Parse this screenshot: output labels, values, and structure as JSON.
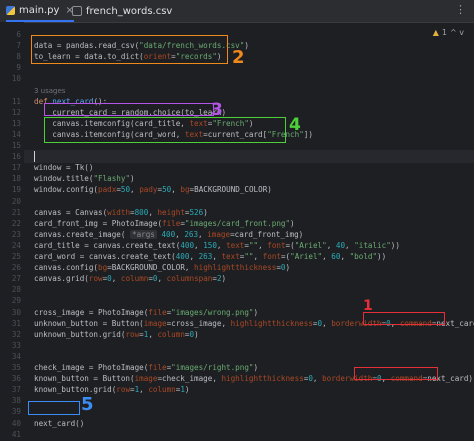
{
  "tabs": [
    {
      "label": "main.py",
      "active": true,
      "icon": "python-file-icon"
    },
    {
      "label": "french_words.csv",
      "active": false,
      "icon": "csv-file-icon"
    }
  ],
  "warnings": {
    "icon": "warning-icon",
    "count": "1",
    "arrows": "^ v"
  },
  "usages_hint": "3 usages",
  "colors": {
    "background": "#1e1f22",
    "keyword": "#cf8e6d",
    "function": "#56a8f5",
    "string": "#6aab73",
    "number": "#2aacb8",
    "parameter": "#aa4926",
    "annotation_red": "#e5303a",
    "annotation_orange": "#f0891b",
    "annotation_purple": "#b455e8",
    "annotation_green": "#4cd03a",
    "annotation_blue": "#3b8cf5"
  },
  "lines": [
    {
      "n": "6",
      "segs": []
    },
    {
      "n": "7",
      "segs": [
        {
          "t": "data = pandas.read_csv("
        },
        {
          "t": "\"data/french_words.csv\"",
          "c": "str"
        },
        {
          "t": ")"
        }
      ]
    },
    {
      "n": "8",
      "segs": [
        {
          "t": "to_learn = data.to_dict("
        },
        {
          "t": "orient",
          "c": "param"
        },
        {
          "t": "="
        },
        {
          "t": "\"records\"",
          "c": "str"
        },
        {
          "t": ")"
        }
      ]
    },
    {
      "n": "9",
      "segs": []
    },
    {
      "n": "10",
      "segs": []
    },
    {
      "n": "",
      "segs": [
        {
          "t": "3 usages",
          "c": "hint"
        }
      ]
    },
    {
      "n": "11",
      "segs": [
        {
          "t": "def ",
          "c": "kw"
        },
        {
          "t": "next_card",
          "c": "fn"
        },
        {
          "t": "():"
        }
      ]
    },
    {
      "n": "12",
      "segs": [
        {
          "t": "    current_card = random.choice(to_learn)"
        }
      ]
    },
    {
      "n": "13",
      "segs": [
        {
          "t": "    canvas.itemconfig(card_title, "
        },
        {
          "t": "text",
          "c": "param"
        },
        {
          "t": "="
        },
        {
          "t": "\"French\"",
          "c": "str"
        },
        {
          "t": ")"
        }
      ]
    },
    {
      "n": "14",
      "segs": [
        {
          "t": "    canvas.itemconfig(card_word, "
        },
        {
          "t": "text",
          "c": "param"
        },
        {
          "t": "=current_card["
        },
        {
          "t": "\"French\"",
          "c": "str"
        },
        {
          "t": "])"
        }
      ]
    },
    {
      "n": "15",
      "segs": []
    },
    {
      "n": "16",
      "segs": []
    },
    {
      "n": "17",
      "segs": [
        {
          "t": "window = Tk()"
        }
      ]
    },
    {
      "n": "18",
      "segs": [
        {
          "t": "window.title("
        },
        {
          "t": "\"Flashy\"",
          "c": "str"
        },
        {
          "t": ")"
        }
      ]
    },
    {
      "n": "19",
      "segs": [
        {
          "t": "window.config("
        },
        {
          "t": "padx",
          "c": "param"
        },
        {
          "t": "="
        },
        {
          "t": "50",
          "c": "num"
        },
        {
          "t": ", "
        },
        {
          "t": "pady",
          "c": "param"
        },
        {
          "t": "="
        },
        {
          "t": "50",
          "c": "num"
        },
        {
          "t": ", "
        },
        {
          "t": "bg",
          "c": "param"
        },
        {
          "t": "=BACKGROUND_COLOR)"
        }
      ]
    },
    {
      "n": "20",
      "segs": []
    },
    {
      "n": "21",
      "segs": [
        {
          "t": "canvas = Canvas("
        },
        {
          "t": "width",
          "c": "param"
        },
        {
          "t": "="
        },
        {
          "t": "800",
          "c": "num"
        },
        {
          "t": ", "
        },
        {
          "t": "height",
          "c": "param"
        },
        {
          "t": "="
        },
        {
          "t": "526",
          "c": "num"
        },
        {
          "t": ")"
        }
      ]
    },
    {
      "n": "22",
      "segs": [
        {
          "t": "card_front_img = PhotoImage("
        },
        {
          "t": "file",
          "c": "param"
        },
        {
          "t": "="
        },
        {
          "t": "\"images/card_front.png\"",
          "c": "str"
        },
        {
          "t": ")"
        }
      ]
    },
    {
      "n": "23",
      "segs": [
        {
          "t": "canvas.create_image( "
        },
        {
          "t": "*args",
          "c": "inlay"
        },
        {
          "t": " "
        },
        {
          "t": "400",
          "c": "num"
        },
        {
          "t": ", "
        },
        {
          "t": "263",
          "c": "num"
        },
        {
          "t": ", "
        },
        {
          "t": "image",
          "c": "param"
        },
        {
          "t": "=card_front_img)"
        }
      ]
    },
    {
      "n": "24",
      "segs": [
        {
          "t": "card_title = canvas.create_text("
        },
        {
          "t": "400",
          "c": "num"
        },
        {
          "t": ", "
        },
        {
          "t": "150",
          "c": "num"
        },
        {
          "t": ", "
        },
        {
          "t": "text",
          "c": "param"
        },
        {
          "t": "="
        },
        {
          "t": "\"\"",
          "c": "str"
        },
        {
          "t": ", "
        },
        {
          "t": "font",
          "c": "param"
        },
        {
          "t": "=("
        },
        {
          "t": "\"Ariel\"",
          "c": "str"
        },
        {
          "t": ", "
        },
        {
          "t": "40",
          "c": "num"
        },
        {
          "t": ", "
        },
        {
          "t": "\"italic\"",
          "c": "str"
        },
        {
          "t": "))"
        }
      ]
    },
    {
      "n": "25",
      "segs": [
        {
          "t": "card_word = canvas.create_text("
        },
        {
          "t": "400",
          "c": "num"
        },
        {
          "t": ", "
        },
        {
          "t": "263",
          "c": "num"
        },
        {
          "t": ", "
        },
        {
          "t": "text",
          "c": "param"
        },
        {
          "t": "="
        },
        {
          "t": "\"\"",
          "c": "str"
        },
        {
          "t": ", "
        },
        {
          "t": "font",
          "c": "param"
        },
        {
          "t": "=("
        },
        {
          "t": "\"Ariel\"",
          "c": "str"
        },
        {
          "t": ", "
        },
        {
          "t": "60",
          "c": "num"
        },
        {
          "t": ", "
        },
        {
          "t": "\"bold\"",
          "c": "str"
        },
        {
          "t": "))"
        }
      ]
    },
    {
      "n": "26",
      "segs": [
        {
          "t": "canvas.config("
        },
        {
          "t": "bg",
          "c": "param"
        },
        {
          "t": "=BACKGROUND_COLOR, "
        },
        {
          "t": "highlightthickness",
          "c": "param"
        },
        {
          "t": "="
        },
        {
          "t": "0",
          "c": "num"
        },
        {
          "t": ")"
        }
      ]
    },
    {
      "n": "27",
      "segs": [
        {
          "t": "canvas.grid("
        },
        {
          "t": "row",
          "c": "param"
        },
        {
          "t": "="
        },
        {
          "t": "0",
          "c": "num"
        },
        {
          "t": ", "
        },
        {
          "t": "column",
          "c": "param"
        },
        {
          "t": "="
        },
        {
          "t": "0",
          "c": "num"
        },
        {
          "t": ", "
        },
        {
          "t": "columnspan",
          "c": "param"
        },
        {
          "t": "="
        },
        {
          "t": "2",
          "c": "num"
        },
        {
          "t": ")"
        }
      ]
    },
    {
      "n": "28",
      "segs": []
    },
    {
      "n": "29",
      "segs": []
    },
    {
      "n": "30",
      "segs": [
        {
          "t": "cross_image = PhotoImage("
        },
        {
          "t": "file",
          "c": "param"
        },
        {
          "t": "="
        },
        {
          "t": "\"images/wrong.png\"",
          "c": "str"
        },
        {
          "t": ")"
        }
      ]
    },
    {
      "n": "31",
      "segs": [
        {
          "t": "unknown_button = Button("
        },
        {
          "t": "image",
          "c": "param"
        },
        {
          "t": "=cross_image, "
        },
        {
          "t": "highlightthickness",
          "c": "param"
        },
        {
          "t": "="
        },
        {
          "t": "0",
          "c": "num"
        },
        {
          "t": ", "
        },
        {
          "t": "borderwidth",
          "c": "param"
        },
        {
          "t": "="
        },
        {
          "t": "0",
          "c": "num"
        },
        {
          "t": ", "
        },
        {
          "t": "command",
          "c": "param"
        },
        {
          "t": "=next_card)"
        }
      ]
    },
    {
      "n": "32",
      "segs": [
        {
          "t": "unknown_button.grid("
        },
        {
          "t": "row",
          "c": "param"
        },
        {
          "t": "="
        },
        {
          "t": "1",
          "c": "num"
        },
        {
          "t": ", "
        },
        {
          "t": "column",
          "c": "param"
        },
        {
          "t": "="
        },
        {
          "t": "0",
          "c": "num"
        },
        {
          "t": ")"
        }
      ]
    },
    {
      "n": "33",
      "segs": []
    },
    {
      "n": "34",
      "segs": []
    },
    {
      "n": "35",
      "segs": [
        {
          "t": "check_image = PhotoImage("
        },
        {
          "t": "file",
          "c": "param"
        },
        {
          "t": "="
        },
        {
          "t": "\"images/right.png\"",
          "c": "str"
        },
        {
          "t": ")"
        }
      ]
    },
    {
      "n": "36",
      "segs": [
        {
          "t": "known_button = Button("
        },
        {
          "t": "image",
          "c": "param"
        },
        {
          "t": "=check_image, "
        },
        {
          "t": "highlightthickness",
          "c": "param"
        },
        {
          "t": "="
        },
        {
          "t": "0",
          "c": "num"
        },
        {
          "t": ", "
        },
        {
          "t": "borderwidth",
          "c": "param"
        },
        {
          "t": "="
        },
        {
          "t": "0",
          "c": "num"
        },
        {
          "t": ", "
        },
        {
          "t": "command",
          "c": "param"
        },
        {
          "t": "=next_card)"
        }
      ]
    },
    {
      "n": "37",
      "segs": [
        {
          "t": "known_button.grid("
        },
        {
          "t": "row",
          "c": "param"
        },
        {
          "t": "="
        },
        {
          "t": "1",
          "c": "num"
        },
        {
          "t": ", "
        },
        {
          "t": "column",
          "c": "param"
        },
        {
          "t": "="
        },
        {
          "t": "1",
          "c": "num"
        },
        {
          "t": ")"
        }
      ]
    },
    {
      "n": "38",
      "segs": []
    },
    {
      "n": "39",
      "segs": []
    },
    {
      "n": "40",
      "segs": [
        {
          "t": "next_card()"
        }
      ]
    },
    {
      "n": "41",
      "segs": []
    }
  ],
  "annotations": [
    {
      "label": "1",
      "color": "red"
    },
    {
      "label": "2",
      "color": "orange"
    },
    {
      "label": "3",
      "color": "purple"
    },
    {
      "label": "4",
      "color": "green"
    },
    {
      "label": "5",
      "color": "blue"
    }
  ]
}
